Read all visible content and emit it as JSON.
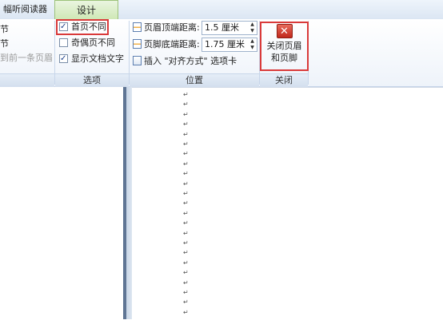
{
  "tabs": {
    "reader": "阅读器",
    "reader_prefix": "幅听",
    "design": "设计"
  },
  "left_group": {
    "items": [
      "节",
      "节",
      "到前一条页眉"
    ]
  },
  "options_group": {
    "label": "选项",
    "checkboxes": [
      {
        "label": "首页不同",
        "checked": true
      },
      {
        "label": "奇偶页不同",
        "checked": false
      },
      {
        "label": "显示文档文字",
        "checked": true
      }
    ]
  },
  "position_group": {
    "label": "位置",
    "header_distance_label": "页眉顶端距离:",
    "header_distance_value": "1.5 厘米",
    "footer_distance_label": "页脚底端距离:",
    "footer_distance_value": "1.75 厘米",
    "insert_tab_label": "插入 \"对齐方式\" 选项卡"
  },
  "close_group": {
    "label": "关闭",
    "button_line1": "关闭页眉",
    "button_line2": "和页脚"
  },
  "colors": {
    "highlight": "#d93a3a",
    "design_tab": "#cfe8b6"
  },
  "document": {
    "paragraph_mark": "↵"
  }
}
